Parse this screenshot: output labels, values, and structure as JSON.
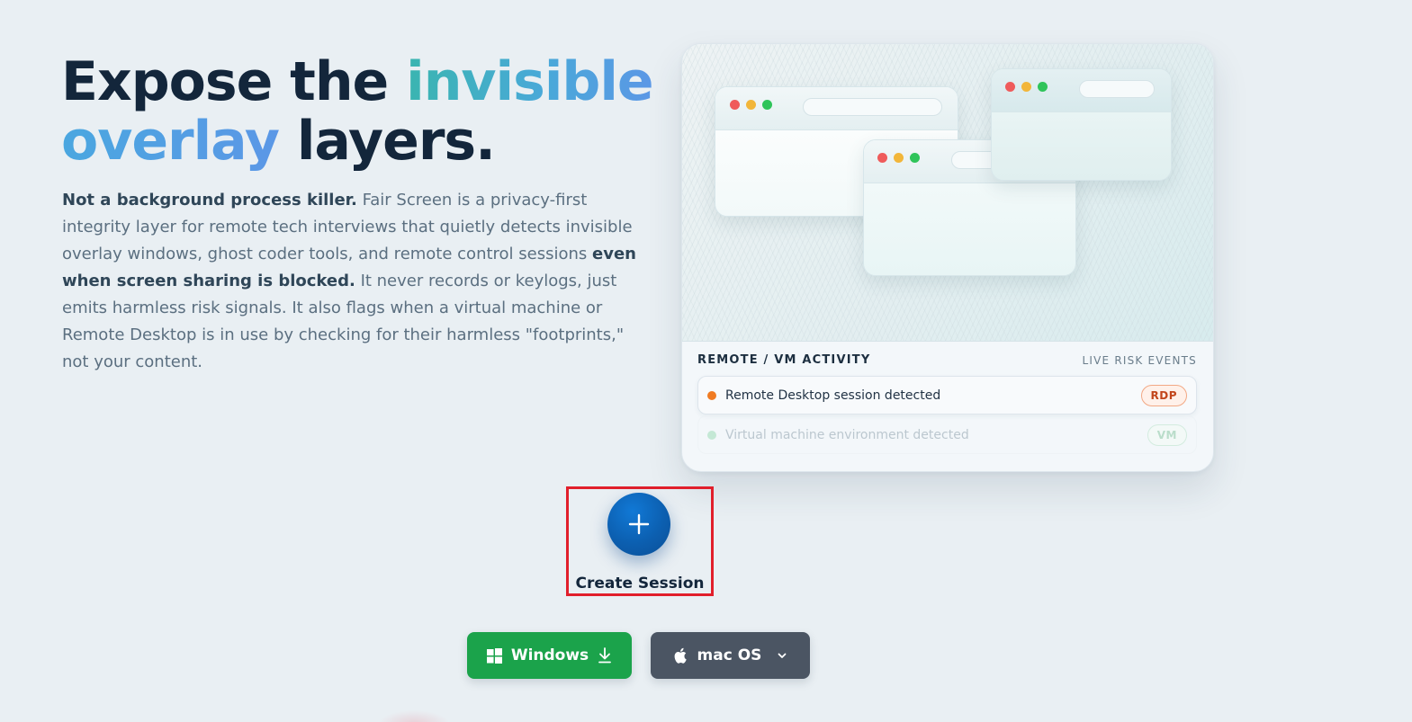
{
  "hero": {
    "title_part1": "Expose the ",
    "title_highlight1": "invisible",
    "title_highlight2": "overlay",
    "title_part2": " layers.",
    "desc_bold1": "Not a background process killer.",
    "desc_text1": " Fair Screen is a privacy-first integrity layer for remote tech interviews that quietly detects invisible overlay windows, ghost coder tools, and remote control sessions ",
    "desc_bold2": "even when screen sharing is blocked.",
    "desc_text2": " It never records or keylogs, just emits harmless risk signals. It also flags when a virtual machine or Remote Desktop is in use by checking for their harmless \"footprints,\" not your content."
  },
  "preview": {
    "activity_title": "REMOTE / VM ACTIVITY",
    "activity_subtitle": "LIVE RISK EVENTS",
    "events": [
      {
        "text": "Remote Desktop session detected",
        "badge": "RDP",
        "status_color": "#f07b22"
      },
      {
        "text": "Virtual machine environment detected",
        "badge": "VM",
        "status_color": "#9fdcb7"
      }
    ]
  },
  "create_session": {
    "icon": "plus-icon",
    "label": "Create Session"
  },
  "downloads": {
    "windows_label": "Windows",
    "windows_icon": "windows-logo-icon",
    "windows_color": "#1ba34b",
    "mac_label": "mac OS",
    "mac_icon": "apple-logo-icon",
    "mac_color": "#4b5563"
  }
}
